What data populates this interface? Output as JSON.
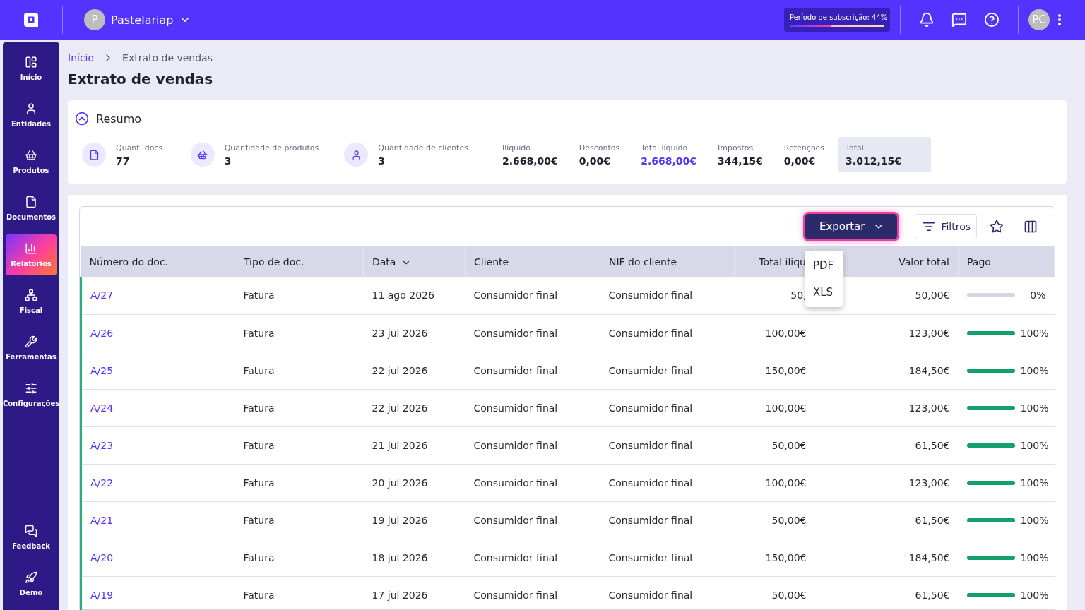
{
  "topbar": {
    "company_initial": "P",
    "company": "Pastelariap",
    "subscription": {
      "label": "Período de subscrição: 44%",
      "level": 0.44
    },
    "user_initials": "PC"
  },
  "sidebar": {
    "items": [
      {
        "label": "Início",
        "selected": false
      },
      {
        "label": "Entidades",
        "selected": false
      },
      {
        "label": "Produtos",
        "selected": false
      },
      {
        "label": "Documentos",
        "selected": false
      },
      {
        "label": "Relatórios",
        "selected": true
      },
      {
        "label": "Fiscal",
        "selected": false
      },
      {
        "label": "Ferramentas",
        "selected": false
      },
      {
        "label": "Configurações",
        "selected": false
      }
    ],
    "bottom_items": [
      {
        "label": "Feedback",
        "selected": false
      },
      {
        "label": "Demo",
        "selected": false
      }
    ]
  },
  "breadcrumb": [
    "Início",
    "Extrato de vendas"
  ],
  "title": "Extrato de vendas",
  "summary": {
    "title": "Resumo",
    "expanded": true,
    "stats": [
      {
        "kind": "count",
        "label": "Quant. docs.",
        "value": "77"
      },
      {
        "kind": "count",
        "label": "Quantidade de produtos",
        "value": "3"
      },
      {
        "kind": "count",
        "label": "Quantidade de clientes",
        "value": "3"
      },
      {
        "kind": "amount",
        "label": "Ilíquido",
        "value": "2.668,00€"
      },
      {
        "kind": "amount",
        "label": "Descontos",
        "value": "0,00€"
      },
      {
        "kind": "net",
        "label": "Total líquido",
        "value": "2.668,00€"
      },
      {
        "kind": "amount",
        "label": "Impostos",
        "value": "344,15€"
      },
      {
        "kind": "amount",
        "label": "Retenções",
        "value": "0,00€"
      },
      {
        "kind": "total",
        "label": "Total",
        "value": "3.012,15€"
      }
    ]
  },
  "toolbar": {
    "export": "Exportar",
    "export_menu": [
      "PDF",
      "XLS"
    ],
    "filters": "Filtros"
  },
  "table": {
    "columns": [
      {
        "label": "Número do doc.",
        "sorted": false
      },
      {
        "label": "Tipo de doc.",
        "sorted": false
      },
      {
        "label": "Data",
        "sorted": true
      },
      {
        "label": "Cliente",
        "sorted": false
      },
      {
        "label": "NIF do cliente",
        "sorted": false
      },
      {
        "label": "Total ilíqu",
        "sorted": false
      },
      {
        "label": "Valor total",
        "sorted": false
      },
      {
        "label": "Pago",
        "sorted": false
      }
    ],
    "rows": [
      {
        "number": "A/27",
        "type": "Fatura",
        "date": "11 ago 2026",
        "client": "Consumidor final",
        "nif": "Consumidor final",
        "net": "50,",
        "total": "50,00€",
        "paid": "0%",
        "level": 0
      },
      {
        "number": "A/26",
        "type": "Fatura",
        "date": "23 jul 2026",
        "client": "Consumidor final",
        "nif": "Consumidor final",
        "net": "100,00€",
        "total": "123,00€",
        "paid": "100%",
        "level": 1
      },
      {
        "number": "A/25",
        "type": "Fatura",
        "date": "22 jul 2026",
        "client": "Consumidor final",
        "nif": "Consumidor final",
        "net": "150,00€",
        "total": "184,50€",
        "paid": "100%",
        "level": 1
      },
      {
        "number": "A/24",
        "type": "Fatura",
        "date": "22 jul 2026",
        "client": "Consumidor final",
        "nif": "Consumidor final",
        "net": "100,00€",
        "total": "123,00€",
        "paid": "100%",
        "level": 1
      },
      {
        "number": "A/23",
        "type": "Fatura",
        "date": "21 jul 2026",
        "client": "Consumidor final",
        "nif": "Consumidor final",
        "net": "50,00€",
        "total": "61,50€",
        "paid": "100%",
        "level": 1
      },
      {
        "number": "A/22",
        "type": "Fatura",
        "date": "20 jul 2026",
        "client": "Consumidor final",
        "nif": "Consumidor final",
        "net": "100,00€",
        "total": "123,00€",
        "paid": "100%",
        "level": 1
      },
      {
        "number": "A/21",
        "type": "Fatura",
        "date": "19 jul 2026",
        "client": "Consumidor final",
        "nif": "Consumidor final",
        "net": "50,00€",
        "total": "61,50€",
        "paid": "100%",
        "level": 1
      },
      {
        "number": "A/20",
        "type": "Fatura",
        "date": "18 jul 2026",
        "client": "Consumidor final",
        "nif": "Consumidor final",
        "net": "150,00€",
        "total": "184,50€",
        "paid": "100%",
        "level": 1
      },
      {
        "number": "A/19",
        "type": "Fatura",
        "date": "17 jul 2026",
        "client": "Consumidor final",
        "nif": "Consumidor final",
        "net": "50,00€",
        "total": "61,50€",
        "paid": "100%",
        "level": 1
      }
    ]
  }
}
